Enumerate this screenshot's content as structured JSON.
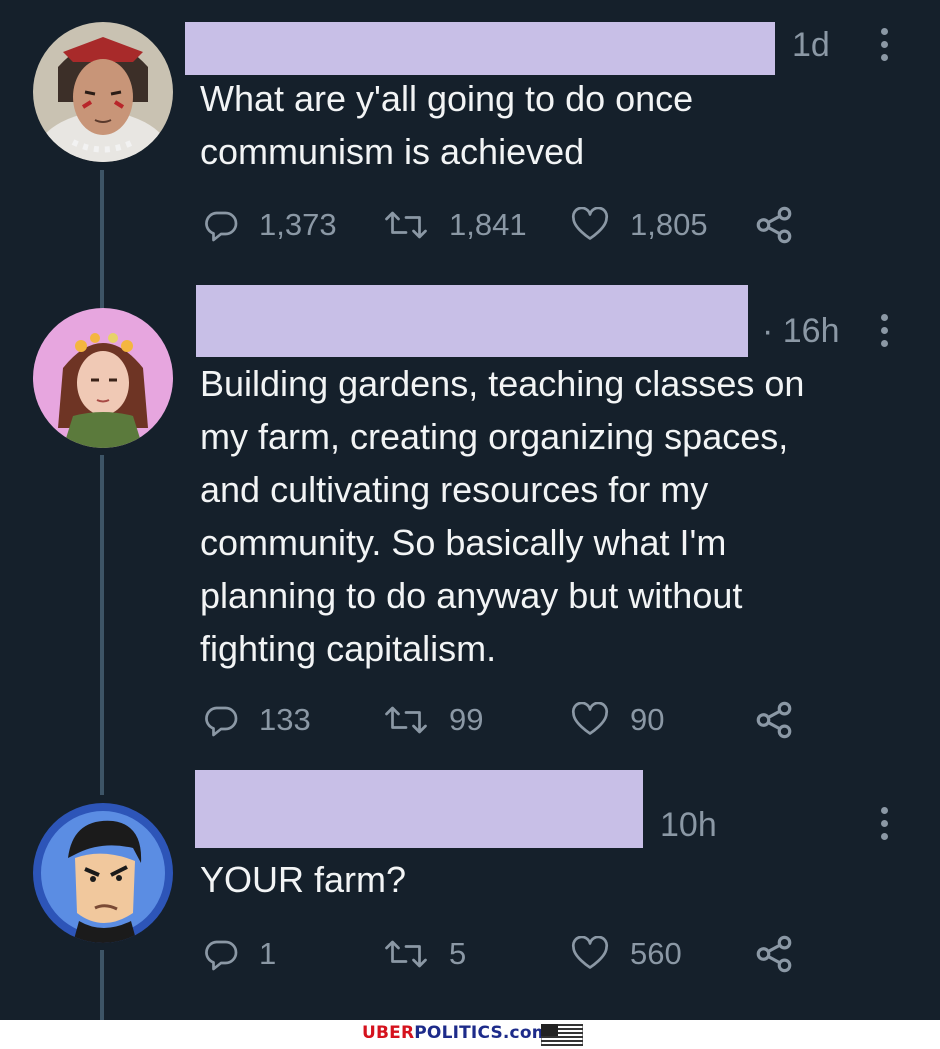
{
  "tweets": [
    {
      "time": "1d",
      "text": "What are y'all going to do once\ncommunism is achieved",
      "replies": "1,373",
      "retweets": "1,841",
      "likes": "1,805"
    },
    {
      "time": "· 16h",
      "text": "Building gardens, teaching classes on\nmy farm,  creating organizing spaces,\nand cultivating resources for my\ncommunity. So basically what I'm\nplanning to do anyway but without\nfighting capitalism.",
      "replies": "133",
      "retweets": "99",
      "likes": "90"
    },
    {
      "time": "10h",
      "text": "YOUR farm?",
      "replies": "1",
      "retweets": "5",
      "likes": "560"
    }
  ],
  "icons": {
    "reply": "reply-icon",
    "retweet": "retweet-icon",
    "like": "heart-icon",
    "share": "share-icon",
    "more": "more-icon"
  },
  "colors": {
    "background": "#15202b",
    "text": "#f2f4f5",
    "muted": "#8b98a5",
    "redaction": "#c8bfe7",
    "thread_line": "#3d5466"
  },
  "watermark": {
    "part1": "UBER",
    "part2": "POLITICS.com"
  }
}
